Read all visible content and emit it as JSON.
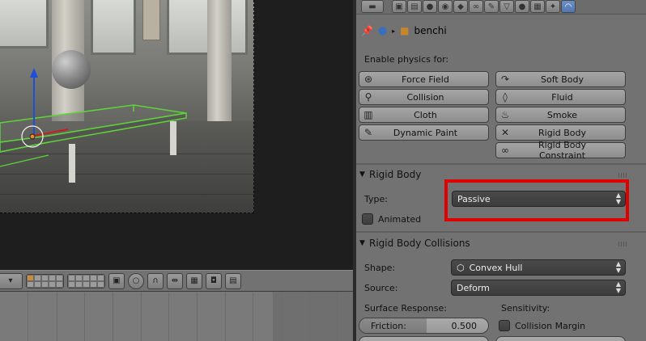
{
  "properties": {
    "breadcrumb": {
      "object_name": "benchi"
    },
    "enable_physics_label": "Enable physics for:",
    "physics_buttons": [
      {
        "label": "Force Field",
        "icon": "force-field-icon"
      },
      {
        "label": "Soft Body",
        "icon": "soft-body-icon"
      },
      {
        "label": "Collision",
        "icon": "collision-icon"
      },
      {
        "label": "Fluid",
        "icon": "fluid-icon"
      },
      {
        "label": "Cloth",
        "icon": "cloth-icon"
      },
      {
        "label": "Smoke",
        "icon": "smoke-icon"
      },
      {
        "label": "Dynamic Paint",
        "icon": "dynamic-paint-icon"
      },
      {
        "label": "Rigid Body",
        "icon": "remove-x-icon"
      },
      {
        "label": "Rigid Body Constraint",
        "icon": "constraint-icon"
      }
    ],
    "rigid_body_panel": {
      "title": "Rigid Body",
      "type_label": "Type:",
      "type_value": "Passive",
      "animated_label": "Animated",
      "animated_checked": false
    },
    "collisions_panel": {
      "title": "Rigid Body Collisions",
      "shape_label": "Shape:",
      "shape_value": "Convex Hull",
      "source_label": "Source:",
      "source_value": "Deform",
      "surface_response_label": "Surface Response:",
      "sensitivity_label": "Sensitivity:",
      "friction_label": "Friction:",
      "friction_value": "0.500",
      "collision_margin_label": "Collision Margin",
      "collision_margin_checked": false
    }
  },
  "colors": {
    "highlight": "#e00000",
    "selection_outline": "#5fd23a",
    "active_context_tab": "#5a82c0",
    "layer_active": "#c88b3a"
  }
}
